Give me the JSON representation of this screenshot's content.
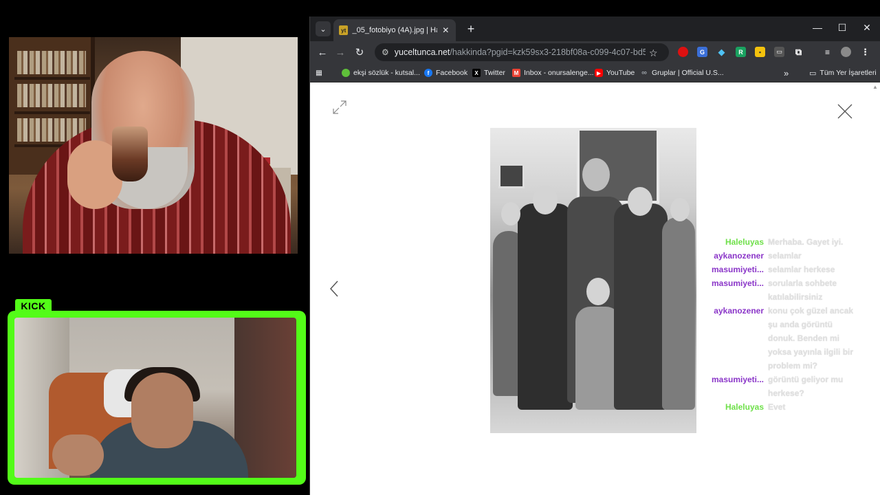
{
  "kick_badge": "KICK",
  "browser": {
    "tab_title": "_05_fotobiyo (4A).jpg | Hakkında",
    "favicon_text": "yt",
    "url_host": "yuceltunca.net",
    "url_path": "/hakkinda?pgid=kzk59sx3-218bf08a-c099-4c07-bd50-e2a...",
    "window_controls": [
      "—",
      "☐",
      "✕"
    ],
    "bookmarks": [
      {
        "label": "ekşi sözlük - kutsal...",
        "icon": "drop-icon",
        "color": "#5fbf3a"
      },
      {
        "label": "Facebook",
        "icon": "facebook-icon",
        "color": "#1877f2"
      },
      {
        "label": "Twitter",
        "icon": "x-icon",
        "color": "#000000"
      },
      {
        "label": "Inbox - onursalenge...",
        "icon": "gmail-icon",
        "color": "#ea4335"
      },
      {
        "label": "YouTube",
        "icon": "youtube-icon",
        "color": "#ff0000"
      },
      {
        "label": "Gruplar | Official U.S...",
        "icon": "link-icon",
        "color": "#9aa0a6"
      }
    ],
    "bookmarks_overflow": "»",
    "all_bookmarks": "Tüm Yer İşaretleri"
  },
  "chat": [
    {
      "user": "Haleluyas",
      "color": "green",
      "text": "Merhaba. Gayet iyi."
    },
    {
      "user": "aykanozener",
      "color": "purple",
      "text": "selamlar"
    },
    {
      "user": "masumiyeti...",
      "color": "purple",
      "text": "selamlar herkese"
    },
    {
      "user": "masumiyeti...",
      "color": "purple",
      "text": "sorularla sohbete katılabilirsiniz"
    },
    {
      "user": "aykanozener",
      "color": "purple",
      "text": "konu çok güzel ancak şu anda görüntü donuk. Benden mi yoksa yayınla ilgili bir problem mi?"
    },
    {
      "user": "masumiyeti...",
      "color": "purple",
      "text": "görüntü geliyor mu herkese?"
    },
    {
      "user": "Haleluyas",
      "color": "green",
      "text": "Evet"
    }
  ]
}
